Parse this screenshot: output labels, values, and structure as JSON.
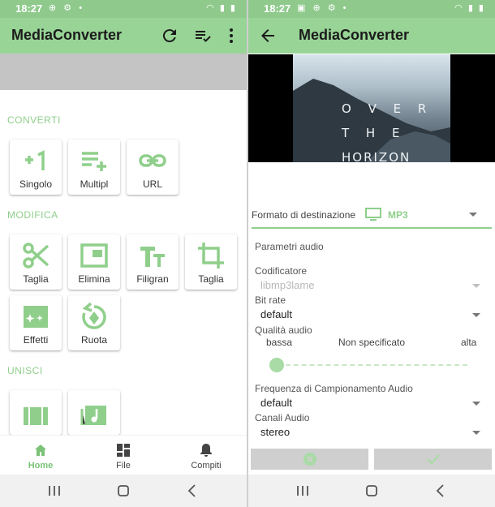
{
  "left": {
    "status": {
      "time": "18:27"
    },
    "app_title": "MediaConverter",
    "sections": {
      "converti": "CONVERTI",
      "modifica": "MODIFICA",
      "unisci": "UNISCI"
    },
    "tiles": {
      "singolo": {
        "label": "Singolo",
        "icon": "plus-one-icon"
      },
      "multipl": {
        "label": "Multipl",
        "icon": "playlist-add-icon"
      },
      "url": {
        "label": "URL",
        "icon": "link-icon"
      },
      "taglia": {
        "label": "Taglia",
        "icon": "scissors-icon"
      },
      "elimina": {
        "label": "Elimina",
        "icon": "picture-in-picture-icon"
      },
      "filigran": {
        "label": "Filigran",
        "icon": "text-fields-icon"
      },
      "taglia_crop": {
        "label": "Taglia",
        "icon": "crop-icon"
      },
      "effetti": {
        "label": "Effetti",
        "icon": "movie-sparkle-icon"
      },
      "ruota": {
        "label": "Ruota",
        "icon": "rotate-icon"
      }
    },
    "bottom_nav": {
      "home": "Home",
      "file": "File",
      "compiti": "Compiti"
    }
  },
  "right": {
    "status": {
      "time": "18:27"
    },
    "app_title": "MediaConverter",
    "video_poster_text": [
      "O V E R",
      "T H E",
      "HORIZON"
    ],
    "format_label": "Formato di destinazione",
    "format_value": "MP3",
    "audio_params_title": "Parametri audio",
    "codec": {
      "label": "Codificatore",
      "value": "libmp3lame"
    },
    "bitrate": {
      "label": "Bit rate",
      "value": "default"
    },
    "quality": {
      "label": "Qualità audio",
      "low": "bassa",
      "mid": "Non specificato",
      "high": "alta",
      "level": 0
    },
    "sample_rate": {
      "label": "Frequenza di Campionamento Audio",
      "value": "default"
    },
    "channels": {
      "label": "Canali Audio",
      "value": "stereo"
    }
  },
  "colors": {
    "accent": "#98d496",
    "accent_dark": "#7cc278",
    "status_bar": "#8fca8c",
    "section_text": "#8fcf8b"
  }
}
